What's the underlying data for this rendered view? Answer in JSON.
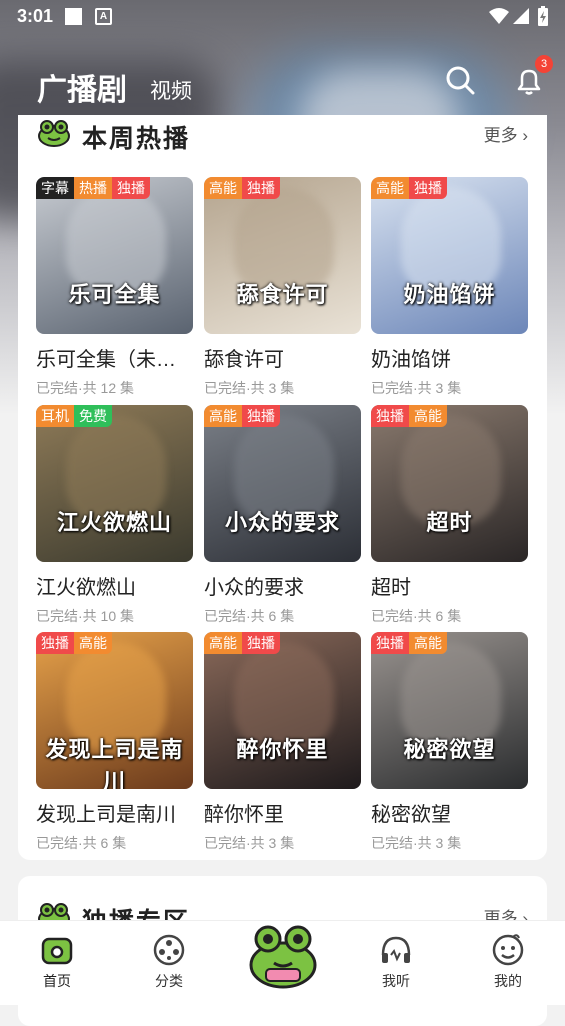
{
  "status_bar": {
    "time": "3:01",
    "battery_icon": "battery-charging-icon",
    "wifi_icon": "wifi-icon",
    "signal_icon": "signal-icon"
  },
  "header": {
    "title": "广播剧",
    "tab_video": "视频",
    "notification_count": "3",
    "search_icon": "search-icon",
    "bell_icon": "bell-icon"
  },
  "section_weekly": {
    "title": "本周热播",
    "more": "更多",
    "items": [
      {
        "name": "乐可全集（未…",
        "status": "已完结·共 12 集",
        "tags": [
          "字幕",
          "热播",
          "独播"
        ],
        "cover_text": "乐可全集",
        "colors": [
          "#5a6370",
          "#c8ccd2"
        ]
      },
      {
        "name": "舔食许可",
        "status": "已完结·共 3 集",
        "tags": [
          "高能",
          "独播"
        ],
        "cover_text": "舔食许可",
        "colors": [
          "#e9e2d6",
          "#b4a48e"
        ]
      },
      {
        "name": "奶油馅饼",
        "status": "已完结·共 3 集",
        "tags": [
          "高能",
          "独播"
        ],
        "cover_text": "奶油馅饼",
        "colors": [
          "#6c86b8",
          "#d8e2f0"
        ]
      },
      {
        "name": "江火欲燃山",
        "status": "已完结·共 10 集",
        "tags": [
          "耳机",
          "免费"
        ],
        "cover_text": "江火欲燃山",
        "colors": [
          "#3b3a2e",
          "#8f7b58"
        ]
      },
      {
        "name": "小众的要求",
        "status": "已完结·共 6 集",
        "tags": [
          "高能",
          "独播"
        ],
        "cover_text": "小众的要求",
        "colors": [
          "#2c2f36",
          "#7b8088"
        ]
      },
      {
        "name": "超时",
        "status": "已完结·共 6 集",
        "tags": [
          "独播",
          "高能"
        ],
        "cover_text": "超时",
        "colors": [
          "#2a2626",
          "#8a7a6e"
        ]
      },
      {
        "name": "发现上司是南川",
        "status": "已完结·共 6 集",
        "tags": [
          "独播",
          "高能"
        ],
        "cover_text": "发现上司是南川",
        "colors": [
          "#6b3a1c",
          "#e7a24a"
        ]
      },
      {
        "name": "醉你怀里",
        "status": "已完结·共 3 集",
        "tags": [
          "高能",
          "独播"
        ],
        "cover_text": "醉你怀里",
        "colors": [
          "#1e1a1c",
          "#8b6a5a"
        ]
      },
      {
        "name": "秘密欲望",
        "status": "已完结·共 3 集",
        "tags": [
          "独播",
          "高能"
        ],
        "cover_text": "秘密欲望",
        "colors": [
          "#2a2c2e",
          "#9a9490"
        ]
      }
    ]
  },
  "section_exclusive": {
    "title": "独播专区",
    "more": "更多"
  },
  "bottom_nav": [
    {
      "label": "首页",
      "icon": "home-icon",
      "active": true
    },
    {
      "label": "分类",
      "icon": "category-icon",
      "active": false
    },
    {
      "label": "",
      "icon": "frog-mascot-icon",
      "active": false
    },
    {
      "label": "我听",
      "icon": "headphones-icon",
      "active": false
    },
    {
      "label": "我的",
      "icon": "profile-icon",
      "active": false
    }
  ],
  "colors": {
    "tag_orange": "#f28b30",
    "tag_red": "#f04a4a",
    "tag_green": "#2fbf5a",
    "tag_dark": "#222222",
    "accent_green": "#6fbf3a",
    "badge_red": "#f44336"
  }
}
